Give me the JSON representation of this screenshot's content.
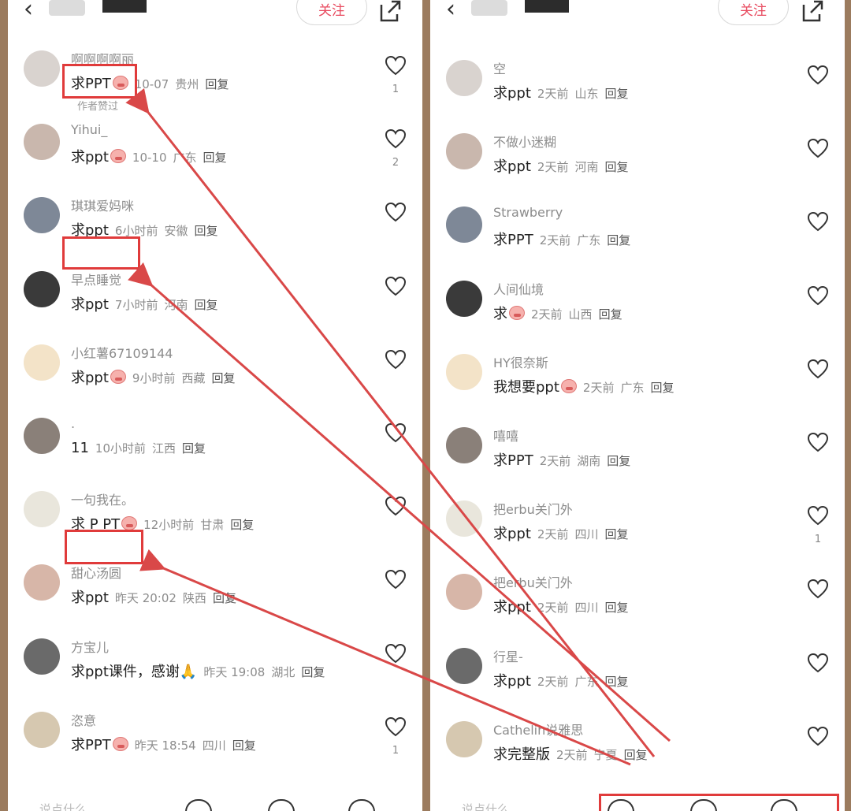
{
  "header": {
    "follow_label": "关注"
  },
  "left_comments": [
    {
      "name": "啊啊啊啊丽",
      "text": "求PPT",
      "emoji": true,
      "date": "10-07",
      "location": "贵州",
      "reply": "回复",
      "liked": "作者赞过",
      "likes": "1"
    },
    {
      "name": "Yihui_",
      "text": "求ppt",
      "emoji": true,
      "date": "10-10",
      "location": "广东",
      "reply": "回复",
      "likes": "2"
    },
    {
      "name": "琪琪爱妈咪",
      "text": "求ppt",
      "emoji": false,
      "date": "6小时前",
      "location": "安徽",
      "reply": "回复"
    },
    {
      "name": "早点睡觉",
      "text": "求ppt",
      "emoji": false,
      "date": "7小时前",
      "location": "河南",
      "reply": "回复"
    },
    {
      "name": "小红薯67109144",
      "text": "求ppt",
      "emoji": true,
      "date": "9小时前",
      "location": "西藏",
      "reply": "回复"
    },
    {
      "name": ".",
      "text": "11",
      "emoji": false,
      "date": "10小时前",
      "location": "江西",
      "reply": "回复"
    },
    {
      "name": "一句我在。",
      "text": "求 P PT",
      "emoji": true,
      "date": "12小时前",
      "location": "甘肃",
      "reply": "回复"
    },
    {
      "name": "甜心汤圆",
      "text": "求ppt",
      "emoji": false,
      "date": "昨天 20:02",
      "location": "陕西",
      "reply": "回复"
    },
    {
      "name": "方宝儿",
      "text": "求ppt课件，感谢🙏",
      "emoji": false,
      "date": "昨天 19:08",
      "location": "湖北",
      "reply": "回复"
    },
    {
      "name": "恣意",
      "text": "求PPT",
      "emoji": true,
      "date": "昨天 18:54",
      "location": "四川",
      "reply": "回复",
      "likes": "1"
    }
  ],
  "right_comments": [
    {
      "name": "空",
      "text": "求ppt",
      "emoji": false,
      "date": "2天前",
      "location": "山东",
      "reply": "回复"
    },
    {
      "name": "不做小迷糊",
      "text": "求ppt",
      "emoji": false,
      "date": "2天前",
      "location": "河南",
      "reply": "回复"
    },
    {
      "name": "Strawberry",
      "text": "求PPT",
      "emoji": false,
      "date": "2天前",
      "location": "广东",
      "reply": "回复"
    },
    {
      "name": "人间仙境",
      "text": "求",
      "emoji": true,
      "date": "2天前",
      "location": "山西",
      "reply": "回复"
    },
    {
      "name": "HY很奈斯",
      "text": "我想要ppt",
      "emoji": true,
      "date": "2天前",
      "location": "广东",
      "reply": "回复"
    },
    {
      "name": "嘻嘻",
      "text": "求PPT",
      "emoji": false,
      "date": "2天前",
      "location": "湖南",
      "reply": "回复"
    },
    {
      "name": "把erbu关门外",
      "text": "求ppt",
      "emoji": false,
      "date": "2天前",
      "location": "四川",
      "reply": "回复",
      "likes": "1"
    },
    {
      "name": "把erbu关门外",
      "text": "求ppt",
      "emoji": false,
      "date": "2天前",
      "location": "四川",
      "reply": "回复"
    },
    {
      "name": "行星-",
      "text": "求ppt",
      "emoji": false,
      "date": "2天前",
      "location": "广东",
      "reply": "回复"
    },
    {
      "name": "Cathelin说雅思",
      "text": "求完整版",
      "emoji": false,
      "date": "2天前",
      "location": "宁夏",
      "reply": "回复"
    }
  ],
  "bottom": {
    "left_placeholder": "说点什么...",
    "right_placeholder": "说点什么..."
  },
  "colors": {
    "highlight": "#e03b3b",
    "arrow": "#d94848",
    "background": "#9b7b5e"
  }
}
